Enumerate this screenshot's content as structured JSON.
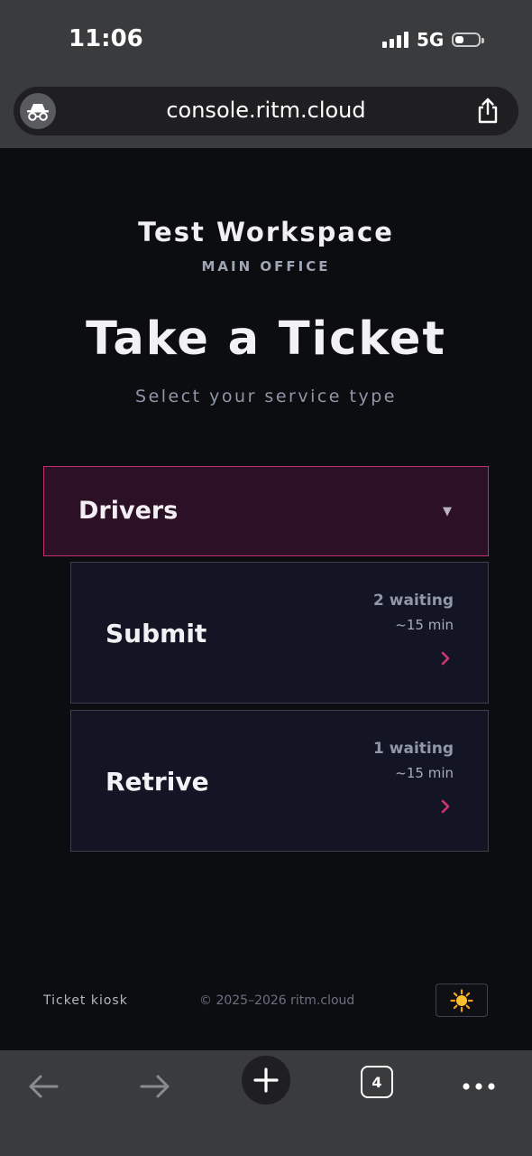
{
  "status_bar": {
    "time": "11:06",
    "network": "5G",
    "icons": [
      "signal-icon",
      "battery-icon"
    ]
  },
  "browser": {
    "url": "console.ritm.cloud",
    "icons": [
      "incognito-icon",
      "share-icon"
    ],
    "bottom_bar": {
      "tab_count": "4",
      "icons": [
        "back-arrow-icon",
        "forward-arrow-icon",
        "plus-icon",
        "tabs-icon",
        "more-icon"
      ]
    }
  },
  "header": {
    "workspace_title": "Test Workspace",
    "workspace_subtitle": "MAIN OFFICE",
    "page_title": "Take a Ticket",
    "page_subtitle": "Select your service type"
  },
  "category": {
    "label": "Drivers",
    "expanded": true,
    "icon": "chevron-down-icon",
    "accent": "#c0306f"
  },
  "services": [
    {
      "name": "Submit",
      "waiting": "2 waiting",
      "eta": "~15 min"
    },
    {
      "name": "Retrive",
      "waiting": "1 waiting",
      "eta": "~15 min"
    }
  ],
  "footer": {
    "left": "Ticket kiosk",
    "copyright": "© 2025–2026 ritm.cloud",
    "theme_icon": "sun-icon"
  },
  "colors": {
    "background": "#0c0d11",
    "card": "#131525",
    "accent": "#d0356f",
    "browser_chrome": "#3a3b3d"
  }
}
